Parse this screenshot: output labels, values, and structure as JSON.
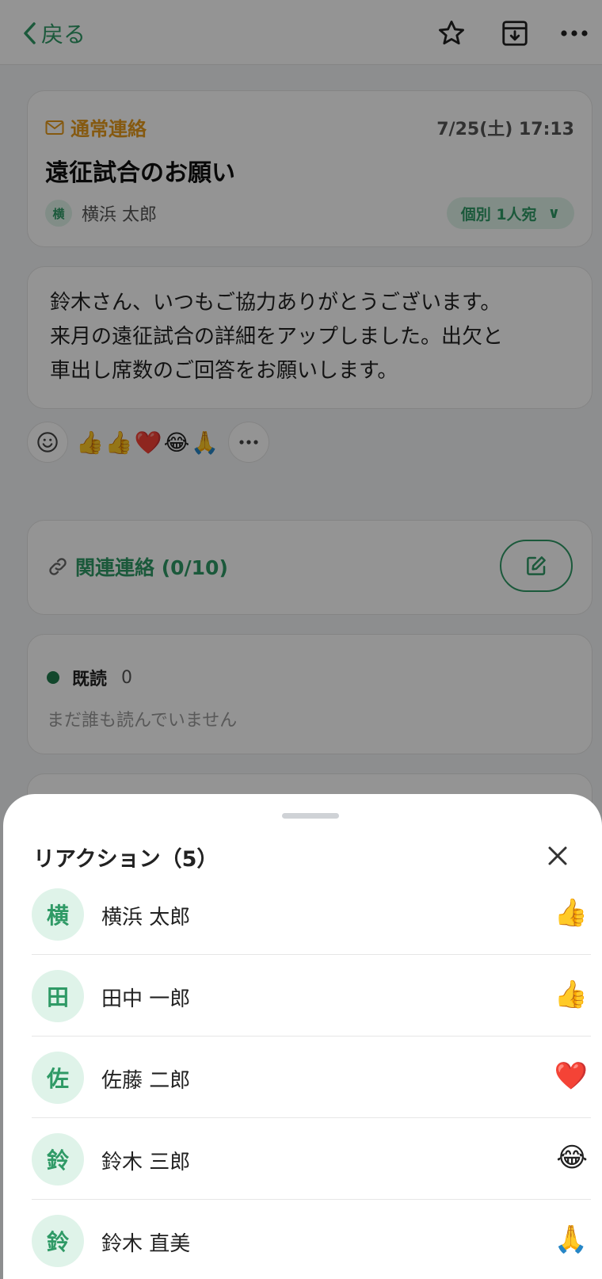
{
  "header": {
    "back_label": "戻る",
    "icons": [
      "chevron-left-icon",
      "star-icon",
      "archive-icon",
      "more-icon"
    ]
  },
  "message": {
    "type_label": "通常連絡",
    "date": "7/25(土) 17:13",
    "title": "遠征試合のお願い",
    "sender_initial": "横",
    "sender_name": "横浜 太郎",
    "recipient_pill": "個別 1人宛",
    "recipient_chevron": "∨",
    "body_lines": [
      "鈴木さん、いつもご協力ありがとうございます。",
      "来月の遠征試合の詳細をアップしました。出欠と",
      "車出し席数のご回答をお願いします。"
    ]
  },
  "reactions_bar": {
    "emojis": [
      "👍",
      "👍",
      "❤️",
      "😂",
      "🙏"
    ]
  },
  "related": {
    "label": "関連連絡 (0/10)"
  },
  "read_status": {
    "label": "既読",
    "count": "0",
    "empty_text": "まだ誰も読んでいません"
  },
  "sheet": {
    "title": "リアクション（5）",
    "items": [
      {
        "initial": "横",
        "name": "横浜 太郎",
        "reaction": "👍"
      },
      {
        "initial": "田",
        "name": "田中 一郎",
        "reaction": "👍"
      },
      {
        "initial": "佐",
        "name": "佐藤 二郎",
        "reaction": "❤️"
      },
      {
        "initial": "鈴",
        "name": "鈴木 三郎",
        "reaction": "😂"
      },
      {
        "initial": "鈴",
        "name": "鈴木 直美",
        "reaction": "🙏"
      }
    ]
  },
  "colors": {
    "accent_green": "#2f9a66",
    "type_orange": "#e59a1c",
    "avatar_bg": "#dff3e9"
  }
}
